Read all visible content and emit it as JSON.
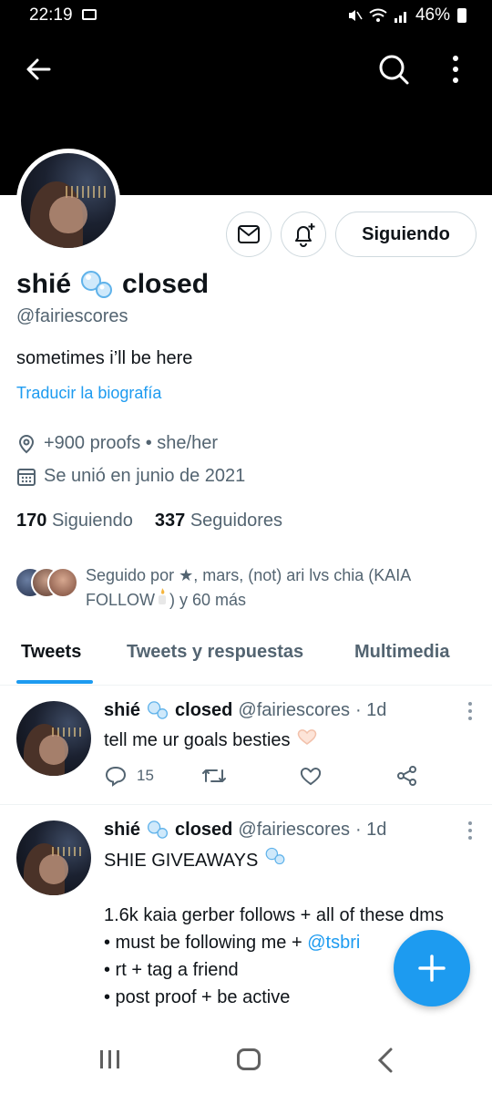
{
  "status_bar": {
    "time": "22:19",
    "battery": "46%"
  },
  "profile": {
    "name": "shié",
    "name_suffix": "closed",
    "handle": "@fairiescores",
    "bio": "sometimes i’ll be here",
    "translate_bio": "Traducir la biografía",
    "location": "+900 proofs • she/her",
    "joined": "Se unió en junio de 2021",
    "following_count": "170",
    "following_label": "Siguiendo",
    "followers_count": "337",
    "followers_label": "Seguidores",
    "follow_button": "Siguiendo",
    "followed_by_line1": "Seguido por ★, mars, (not) ari lvs chia (KAIA",
    "followed_by_line2_a": "FOLLOW",
    "followed_by_line2_b": ") y 60 más"
  },
  "tabs": [
    {
      "label": "Tweets",
      "selected": true
    },
    {
      "label": "Tweets y respuestas",
      "selected": false
    },
    {
      "label": "Multimedia",
      "selected": false
    }
  ],
  "tweets": [
    {
      "name": "shié",
      "name_suffix": "closed",
      "handle": "@fairiescores",
      "time": "· 1d",
      "text": "tell me ur goals besties",
      "reply_count": "15"
    },
    {
      "name": "shié",
      "name_suffix": "closed",
      "handle": "@fairiescores",
      "time": "· 1d",
      "line1": "SHIE GIVEAWAYS",
      "line2": "1.6k kaia gerber follows + all of these dms",
      "line3_prefix": "• must be following me +",
      "line3_mention": "@tsbri",
      "line4": "• rt + tag a friend",
      "line5": "• post proof + be active"
    }
  ],
  "colors": {
    "accent": "#1d9bf0",
    "text": "#0f1419",
    "secondary": "#536471"
  }
}
